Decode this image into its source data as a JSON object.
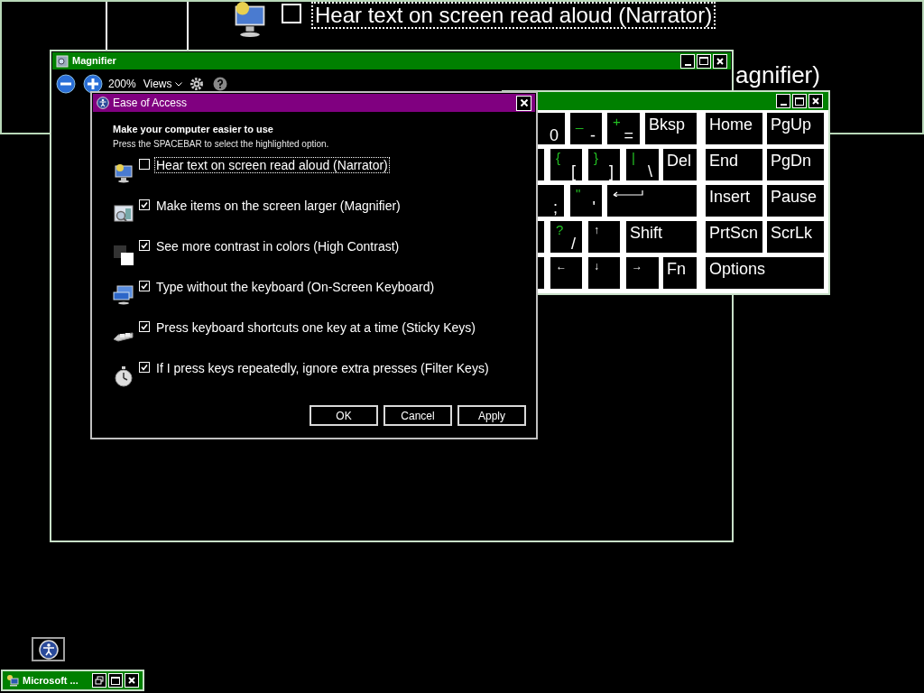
{
  "lens": {
    "checked": false,
    "focused": true,
    "option": "Hear text on screen read aloud (Narrator)",
    "fragment": "agnifier)"
  },
  "magnifier": {
    "title": "Magnifier",
    "zoom": "200%",
    "views": "Views"
  },
  "keyboard": {
    "main_keys": [
      [
        {
          "kind": "char",
          "main": "0"
        },
        {
          "kind": "char",
          "shift": "_",
          "main": "-"
        },
        {
          "kind": "char",
          "shift": "+",
          "main": "="
        },
        {
          "kind": "label",
          "label": "Bksp"
        }
      ],
      [
        {
          "kind": "blank"
        },
        {
          "kind": "char",
          "shift": "{",
          "main": "["
        },
        {
          "kind": "char",
          "shift": "}",
          "main": "]"
        },
        {
          "kind": "char",
          "shift": "|",
          "main": "\\"
        },
        {
          "kind": "label",
          "label": "Del"
        }
      ],
      [
        {
          "kind": "char",
          "main": ";"
        },
        {
          "kind": "char",
          "shift": "\"",
          "main": "'"
        },
        {
          "kind": "enter"
        }
      ],
      [
        {
          "kind": "blank"
        },
        {
          "kind": "char",
          "shift": "?",
          "main": "/"
        },
        {
          "kind": "arrow",
          "label": "↑"
        },
        {
          "kind": "label",
          "label": "Shift"
        }
      ],
      [
        {
          "kind": "blank"
        },
        {
          "kind": "arrow",
          "label": "←"
        },
        {
          "kind": "arrow",
          "label": "↓"
        },
        {
          "kind": "arrow",
          "label": "→"
        },
        {
          "kind": "label",
          "label": "Fn"
        }
      ]
    ],
    "nav_keys": [
      [
        {
          "kind": "label",
          "label": "Home"
        },
        {
          "kind": "label",
          "label": "PgUp"
        }
      ],
      [
        {
          "kind": "label",
          "label": "End"
        },
        {
          "kind": "label",
          "label": "PgDn"
        }
      ],
      [
        {
          "kind": "label",
          "label": "Insert"
        },
        {
          "kind": "label",
          "label": "Pause"
        }
      ],
      [
        {
          "kind": "label",
          "label": "PrtScn"
        },
        {
          "kind": "label",
          "label": "ScrLk"
        }
      ],
      [
        {
          "kind": "label",
          "label": "Options"
        }
      ]
    ]
  },
  "dialog": {
    "title": "Ease of Access",
    "heading": "Make your computer easier to use",
    "hint": "Press the SPACEBAR to select the highlighted option.",
    "options": [
      {
        "label": "Hear text on screen read aloud (Narrator)",
        "checked": false,
        "focused": true
      },
      {
        "label": "Make items on the screen larger (Magnifier)",
        "checked": true,
        "focused": false
      },
      {
        "label": "See more contrast in colors (High Contrast)",
        "checked": true,
        "focused": false
      },
      {
        "label": "Type without the keyboard (On-Screen Keyboard)",
        "checked": true,
        "focused": false
      },
      {
        "label": "Press keyboard shortcuts one key at a time (Sticky Keys)",
        "checked": true,
        "focused": false
      },
      {
        "label": "If I press keys repeatedly, ignore extra presses (Filter Keys)",
        "checked": true,
        "focused": false
      }
    ],
    "buttons": [
      "OK",
      "Cancel",
      "Apply"
    ]
  },
  "minimized_window": {
    "title": "Microsoft ..."
  }
}
